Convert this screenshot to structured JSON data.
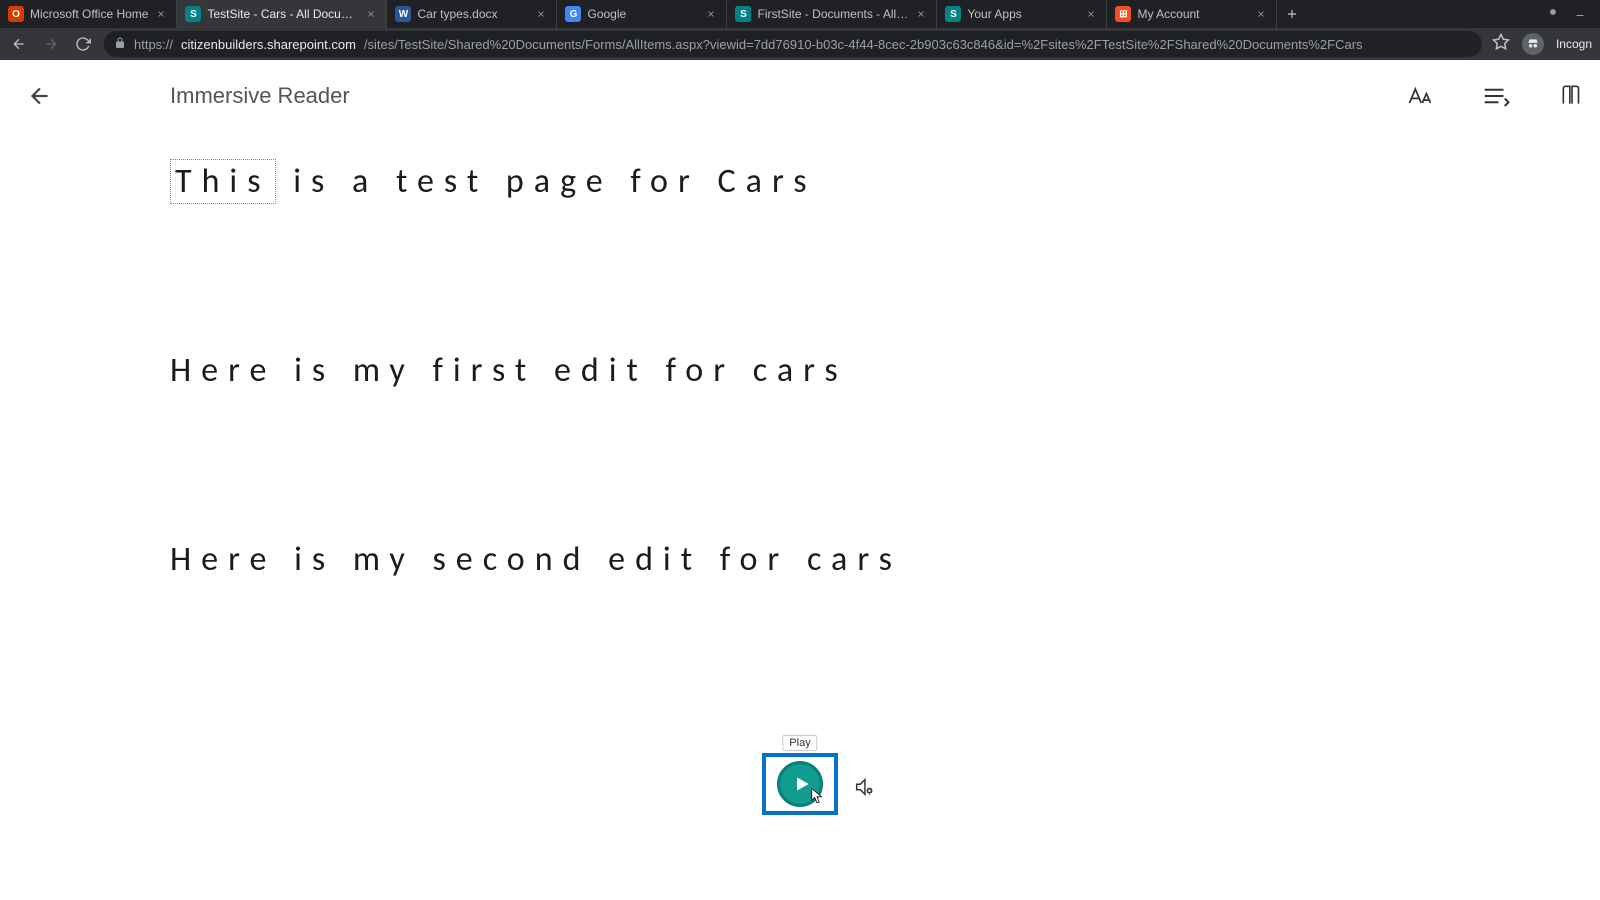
{
  "tabs": [
    {
      "title": "Microsoft Office Home",
      "iconColor": "#d83b01",
      "iconGlyph": "O"
    },
    {
      "title": "TestSite - Cars - All Documents",
      "iconColor": "#038387",
      "iconGlyph": "S",
      "active": true
    },
    {
      "title": "Car types.docx",
      "iconColor": "#2b579a",
      "iconGlyph": "W"
    },
    {
      "title": "Google",
      "iconColor": "#4285f4",
      "iconGlyph": "G"
    },
    {
      "title": "FirstSite - Documents - All Docu…",
      "iconColor": "#038387",
      "iconGlyph": "S"
    },
    {
      "title": "Your Apps",
      "iconColor": "#038387",
      "iconGlyph": "S"
    },
    {
      "title": "My Account",
      "iconColor": "#f25022",
      "iconGlyph": "⊞"
    }
  ],
  "url": {
    "host": "citizenbuilders.sharepoint.com",
    "rest": "/sites/TestSite/Shared%20Documents/Forms/AllItems.aspx?viewid=7dd76910-b03c-4f44-8cec-2b903c63c846&id=%2Fsites%2FTestSite%2FShared%20Documents%2FCars"
  },
  "incognito_label": "Incogn",
  "reader": {
    "title": "Immersive Reader",
    "paragraphs": [
      {
        "highlight": "This",
        "rest": " is a test page for Cars"
      },
      {
        "highlight": null,
        "rest": "Here is my first edit for cars"
      },
      {
        "highlight": null,
        "rest": "Here is my second edit for cars"
      }
    ]
  },
  "play": {
    "tooltip": "Play"
  }
}
